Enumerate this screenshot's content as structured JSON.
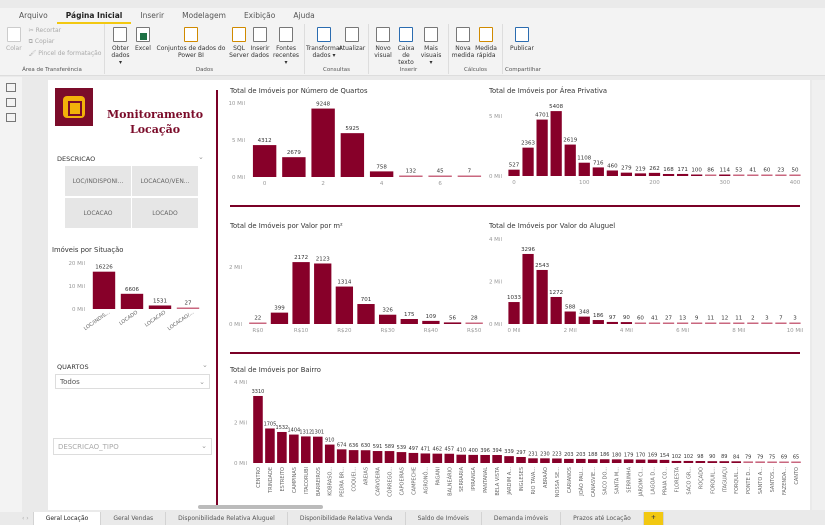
{
  "ribbon_tabs": [
    "Arquivo",
    "Página Inicial",
    "Inserir",
    "Modelagem",
    "Exibição",
    "Ajuda"
  ],
  "ribbon": {
    "clipboard": {
      "paste": "Colar",
      "cut": "Recortar",
      "copy": "Copiar",
      "format_painter": "Pincel de formatação",
      "label": "Área de Transferência"
    },
    "data": {
      "items": [
        "Obter dados ▾",
        "Excel",
        "Conjuntos de dados do Power BI",
        "SQL Server",
        "Inserir dados",
        "Fontes recentes ▾"
      ],
      "label": "Dados"
    },
    "queries": {
      "items": [
        "Transformar dados ▾",
        "Atualizar"
      ],
      "label": "Consultas"
    },
    "insert": {
      "items": [
        "Novo visual",
        "Caixa de texto",
        "Mais visuais ▾"
      ],
      "label": "Inserir"
    },
    "calc": {
      "items": [
        "Nova medida",
        "Medida rápida"
      ],
      "label": "Cálculos"
    },
    "share": {
      "items": [
        "Publicar"
      ],
      "label": "Compartilhar"
    }
  },
  "brand": {
    "line1": "Monitoramento",
    "line2": "Locação"
  },
  "filters": {
    "descricao": {
      "label": "DESCRICAO",
      "tiles": [
        "LOC/INDISPONI...",
        "LOCACAO/VEN...",
        "LOCACAO",
        "LOCADO"
      ]
    },
    "quartos": {
      "label": "QUARTOS",
      "value": "Todos"
    },
    "descricao_tipo": {
      "placeholder": "DESCRICAO_TIPO"
    }
  },
  "colors": {
    "bar": "#870029",
    "accent": "#7a0026",
    "tab_accent": "#f2c811"
  },
  "chart_data": [
    {
      "id": "situacao",
      "type": "bar",
      "title": "Imóveis por Situação",
      "categories": [
        "LOC/INDIS...",
        "LOCADO",
        "LOCACAO",
        "LOCACAO/..."
      ],
      "values": [
        16226,
        6606,
        1531,
        27
      ],
      "ylim": [
        0,
        20000
      ],
      "yticks": [
        {
          "value": 0,
          "label": "0 Mil"
        },
        {
          "value": 10000,
          "label": "10 Mil"
        },
        {
          "value": 20000,
          "label": "20 Mil"
        }
      ],
      "rotate_labels": true
    },
    {
      "id": "quartos",
      "type": "bar",
      "title": "Total de Imóveis por Número de Quartos",
      "categories": [
        0,
        1,
        2,
        3,
        4,
        5,
        6,
        7
      ],
      "values": [
        4312,
        2679,
        9248,
        5925,
        758,
        132,
        45,
        7
      ],
      "ylim": [
        0,
        10000
      ],
      "yticks": [
        {
          "value": 0,
          "label": "0 Mil"
        },
        {
          "value": 5000,
          "label": "5 Mil"
        },
        {
          "value": 10000,
          "label": "10 Mil"
        }
      ],
      "xticks": [
        {
          "at": 0,
          "label": "0"
        },
        {
          "at": 2,
          "label": "2"
        },
        {
          "at": 4,
          "label": "4"
        },
        {
          "at": 6,
          "label": "6"
        }
      ]
    },
    {
      "id": "area",
      "type": "bar",
      "title": "Total de Imóveis por Área Privativa",
      "categories": [
        0,
        20,
        40,
        60,
        80,
        100,
        120,
        140,
        160,
        180,
        200,
        220,
        240,
        260,
        280,
        300,
        320,
        340,
        360,
        380,
        400
      ],
      "values": [
        527,
        2363,
        4701,
        5408,
        2619,
        1108,
        716,
        460,
        279,
        219,
        262,
        168,
        171,
        100,
        86,
        114,
        53,
        41,
        60,
        23,
        50
      ],
      "ylim": [
        0,
        5000
      ],
      "yticks": [
        {
          "value": 0,
          "label": "0 Mil"
        },
        {
          "value": 5000,
          "label": "5 Mil"
        }
      ],
      "xticks": [
        {
          "at": 0,
          "label": "0"
        },
        {
          "at": 100,
          "label": "100"
        },
        {
          "at": 200,
          "label": "200"
        },
        {
          "at": 300,
          "label": "300"
        },
        {
          "at": 400,
          "label": "400"
        }
      ]
    },
    {
      "id": "m2",
      "type": "bar",
      "title": "Total de Imóveis por Valor por m²",
      "categories": [
        0,
        5,
        10,
        15,
        20,
        25,
        30,
        35,
        40,
        45,
        50
      ],
      "values": [
        22,
        399,
        2172,
        2123,
        1314,
        701,
        326,
        175,
        109,
        56,
        28
      ],
      "ylim": [
        0,
        2000
      ],
      "yticks": [
        {
          "value": 0,
          "label": "0 Mil"
        },
        {
          "value": 2000,
          "label": "2 Mil"
        }
      ],
      "xticks": [
        {
          "at": 0,
          "label": "R$0"
        },
        {
          "at": 10,
          "label": "R$10"
        },
        {
          "at": 20,
          "label": "R$20"
        },
        {
          "at": 30,
          "label": "R$30"
        },
        {
          "at": 40,
          "label": "R$40"
        },
        {
          "at": 50,
          "label": "R$50"
        }
      ]
    },
    {
      "id": "aluguel",
      "type": "bar",
      "title": "Total de Imóveis por Valor do Aluguel",
      "categories": [
        0,
        500,
        1000,
        1500,
        2000,
        2500,
        3000,
        3500,
        4000,
        4500,
        5000,
        5500,
        6000,
        6500,
        7000,
        7500,
        8000,
        8500,
        9000,
        9500,
        10000
      ],
      "values": [
        1033,
        3296,
        2543,
        1272,
        588,
        348,
        186,
        97,
        90,
        60,
        41,
        27,
        13,
        9,
        11,
        12,
        11,
        2,
        3,
        7,
        3
      ],
      "ylim": [
        0,
        4000
      ],
      "yticks": [
        {
          "value": 0,
          "label": "0 Mil"
        },
        {
          "value": 2000,
          "label": "2 Mil"
        },
        {
          "value": 4000,
          "label": "4 Mil"
        }
      ],
      "xticks": [
        {
          "at": 0,
          "label": "0 Mil"
        },
        {
          "at": 2000,
          "label": "2 Mil"
        },
        {
          "at": 4000,
          "label": "4 Mil"
        },
        {
          "at": 6000,
          "label": "6 Mil"
        },
        {
          "at": 8000,
          "label": "8 Mil"
        },
        {
          "at": 10000,
          "label": "10 Mil"
        }
      ]
    },
    {
      "id": "bairro",
      "type": "bar",
      "title": "Total de Imóveis por Bairro",
      "categories": [
        "CENTRO",
        "TRINDADE",
        "ESTREITO",
        "CAMPINAS",
        "ITACORUBI",
        "BARREIROS",
        "KOBRASO...",
        "PEDRA BR...",
        "COQUEI...",
        "AREIAS",
        "CARVOEIRA",
        "CÓRREGO...",
        "CAPOEIRAS",
        "CAMPECHE",
        "AGRONÔ...",
        "PAGANI",
        "BALNEÁRIO",
        "SERRARIA",
        "IPIRANGA",
        "PANTANAL",
        "BELA VISTA",
        "JARDIM A...",
        "INGLESES",
        "RIO TAVA...",
        "ABRAÃO",
        "NOSSA SE...",
        "CARIANOS",
        "JOÃO PAU...",
        "CANASVIE...",
        "SACO DO...",
        "SANTA M...",
        "SERRINHA",
        "JARDIM CI...",
        "LAGOA D...",
        "PRAIA CO...",
        "FLORESTA",
        "SACO GR...",
        "ROÇADO",
        "FORQUIL...",
        "ITAGUAÇU",
        "FORQUIL...",
        "PONTE D...",
        "SANTO A...",
        "SANTOS...",
        "FAZENDA...",
        "CANTO"
      ],
      "values": [
        3310,
        1705,
        1532,
        1404,
        1312,
        1301,
        910,
        674,
        636,
        630,
        591,
        589,
        539,
        497,
        471,
        462,
        457,
        410,
        400,
        396,
        394,
        339,
        297,
        231,
        230,
        223,
        203,
        203,
        188,
        186,
        180,
        179,
        170,
        169,
        154,
        102,
        102,
        98,
        90,
        89,
        84,
        79,
        79,
        75,
        69,
        65
      ],
      "ylim": [
        0,
        4000
      ],
      "yticks": [
        {
          "value": 0,
          "label": "0 Mil"
        },
        {
          "value": 2000,
          "label": "2 Mil"
        },
        {
          "value": 4000,
          "label": "4 Mil"
        }
      ],
      "rotate_labels": true
    }
  ],
  "page_tabs": [
    "Geral Locação",
    "Geral Vendas",
    "Disponibilidade Relativa Aluguel",
    "Disponibilidade Relativa Venda",
    "Saldo de Imóveis",
    "Demanda imóveis",
    "Prazos até Locação",
    "+"
  ]
}
